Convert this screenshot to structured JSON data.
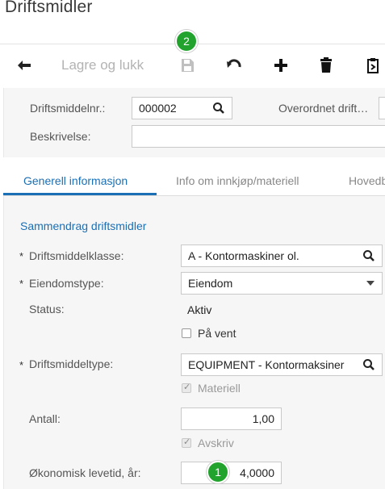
{
  "page": {
    "title": "Driftsmidler"
  },
  "toolbar": {
    "back_icon": "arrow-left-icon",
    "save_close_label": "Lagre og lukk",
    "save_icon": "floppy-disk-icon",
    "undo_icon": "undo-icon",
    "add_icon": "plus-icon",
    "delete_icon": "trash-icon",
    "copy_icon": "clipboard-icon",
    "badge_save": "2"
  },
  "header": {
    "asset_no_label": "Driftsmiddelnr.:",
    "asset_no_value": "000002",
    "parent_label": "Overordnet drift…",
    "description_label": "Beskrivelse:",
    "description_value": ""
  },
  "tabs": [
    {
      "label": "Generell informasjon"
    },
    {
      "label": "Info om innkjøp/materiell"
    },
    {
      "label": "Hovedb"
    }
  ],
  "summary": {
    "section_title": "Sammendrag driftsmidler",
    "required_mark": "*",
    "asset_class_label": "Driftsmiddelklasse:",
    "asset_class_value": "A - Kontormaskiner ol.",
    "property_type_label": "Eiendomstype:",
    "property_type_value": "Eiendom",
    "status_label": "Status:",
    "status_value": "Aktiv",
    "on_hold_label": "På vent",
    "on_hold_checked": false,
    "asset_type_label": "Driftsmiddeltype:",
    "asset_type_value": "EQUIPMENT - Kontormaksiner",
    "material_label": "Materiell",
    "material_checked": true,
    "quantity_label": "Antall:",
    "quantity_value": "1,00",
    "depreciate_label": "Avskriv",
    "depreciate_checked": true,
    "useful_life_label": "Økonomisk levetid, år:",
    "useful_life_value": "4,0000",
    "badge_life": "1"
  },
  "colors": {
    "accent": "#1a6fb5",
    "badge": "#22a32d"
  }
}
